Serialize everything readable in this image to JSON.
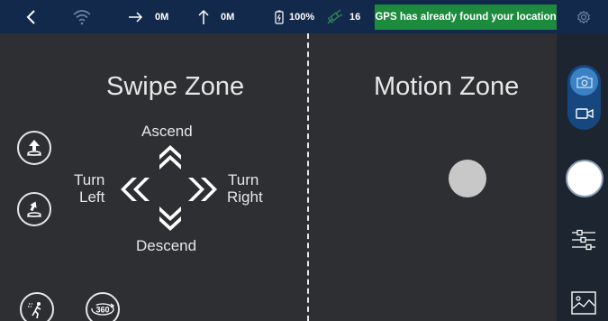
{
  "topbar": {
    "distance_horizontal": "0M",
    "distance_vertical": "0M",
    "battery": "100%",
    "satellites": "16",
    "gps_status": "GPS has already found your location"
  },
  "swipe_zone": {
    "title": "Swipe Zone",
    "ascend": "Ascend",
    "descend": "Descend",
    "turn_left_1": "Turn",
    "turn_left_2": "Left",
    "turn_right_1": "Turn",
    "turn_right_2": "Right"
  },
  "motion_zone": {
    "title": "Motion Zone"
  },
  "buttons": {
    "rotate_360_label": "360"
  },
  "colors": {
    "topbar_bg": "#13294b",
    "gps_banner_bg": "#1d8b3e",
    "panel_bg": "#2d2f32",
    "sidebar_bg": "#1c2530",
    "mode_accent": "#3b82c4"
  },
  "icons": {
    "topbar": [
      "back-arrow-icon",
      "wifi-icon",
      "horizontal-distance-icon",
      "altitude-icon",
      "battery-icon",
      "satellite-icon",
      "settings-icon"
    ],
    "left": [
      "takeoff-icon",
      "landing-icon",
      "follow-me-icon",
      "rotate-360-icon"
    ],
    "sidebar": [
      "photo-mode-icon",
      "video-mode-icon",
      "shutter-icon",
      "adjust-sliders-icon",
      "gallery-icon"
    ]
  }
}
